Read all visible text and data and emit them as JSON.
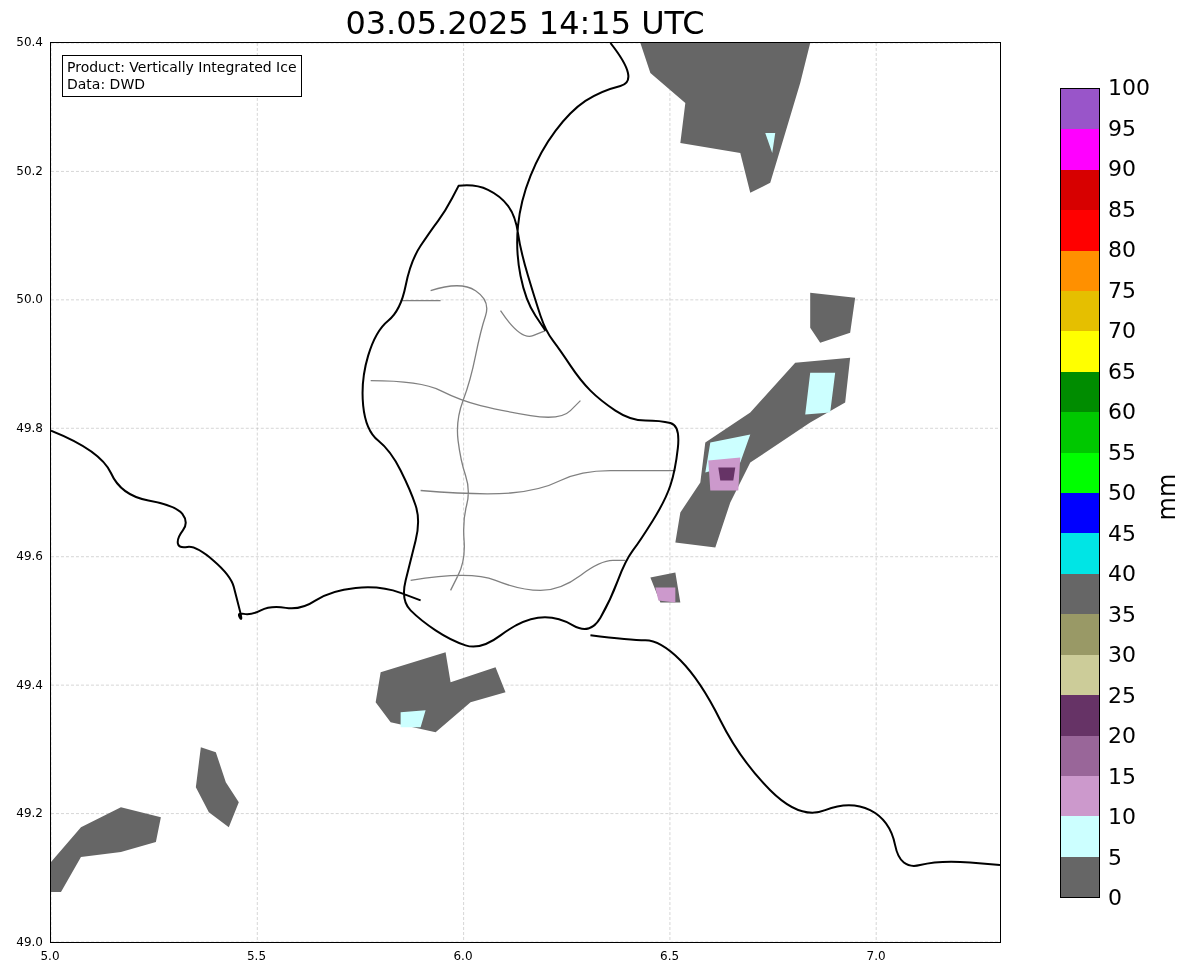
{
  "title": "03.05.2025 14:15 UTC",
  "info_box": {
    "lines": [
      "Product: Vertically Integrated Ice",
      "Data: DWD"
    ]
  },
  "map": {
    "xticks": [
      "5.0",
      "5.5",
      "6.0",
      "6.5",
      "7.0"
    ],
    "yticks": [
      "50.4",
      "50.2",
      "50.0",
      "49.8",
      "49.6",
      "49.4",
      "49.2",
      "49.0"
    ]
  },
  "colorbar": {
    "label": "mm",
    "ticks": [
      "100",
      "95",
      "90",
      "85",
      "80",
      "75",
      "70",
      "65",
      "60",
      "55",
      "50",
      "45",
      "40",
      "35",
      "30",
      "25",
      "20",
      "15",
      "10",
      "5",
      "0"
    ],
    "bins": [
      {
        "color": "#9955c9"
      },
      {
        "color": "#ff00ff"
      },
      {
        "color": "#d70000"
      },
      {
        "color": "#ff0000"
      },
      {
        "color": "#ff9000"
      },
      {
        "color": "#e5bf00"
      },
      {
        "color": "#ffff00"
      },
      {
        "color": "#008c00"
      },
      {
        "color": "#00c800"
      },
      {
        "color": "#00ff00"
      },
      {
        "color": "#0000ff"
      },
      {
        "color": "#00e5e5"
      },
      {
        "color": "#666666"
      },
      {
        "color": "#999966"
      },
      {
        "color": "#cccc99"
      },
      {
        "color": "#663366"
      },
      {
        "color": "#996699"
      },
      {
        "color": "#cc99cc"
      },
      {
        "color": "#ccffff"
      },
      {
        "color": "#666666"
      }
    ]
  }
}
